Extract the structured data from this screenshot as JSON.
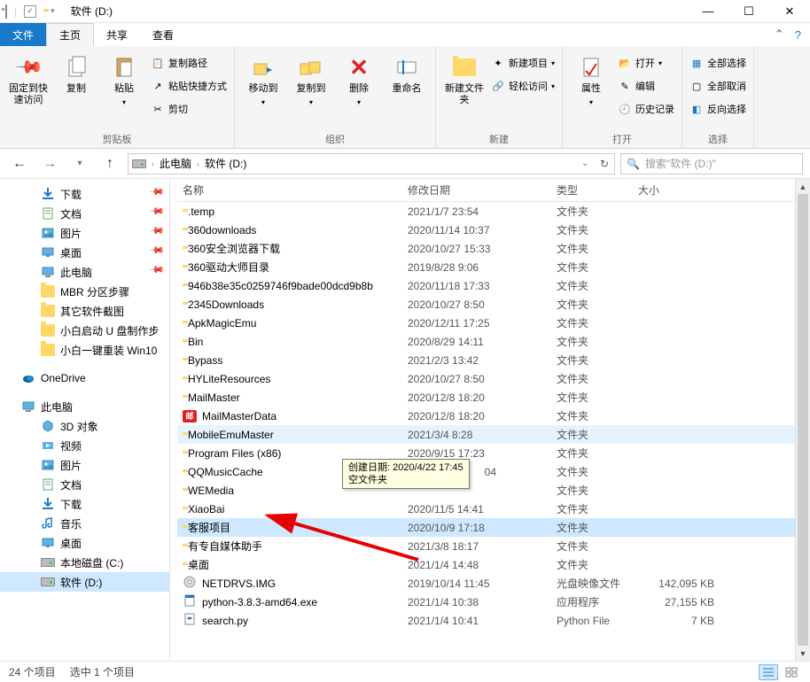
{
  "window": {
    "title": "软件 (D:)",
    "min": "—",
    "max": "☐",
    "close": "✕"
  },
  "tabs": {
    "file": "文件",
    "home": "主页",
    "share": "共享",
    "view": "查看"
  },
  "ribbon": {
    "group_clipboard": "剪贴板",
    "group_organize": "组织",
    "group_new": "新建",
    "group_open": "打开",
    "group_select": "选择",
    "pin_quick": "固定到快速访问",
    "copy": "复制",
    "paste": "粘贴",
    "copy_path": "复制路径",
    "paste_shortcut": "粘贴快捷方式",
    "cut": "剪切",
    "move_to": "移动到",
    "copy_to": "复制到",
    "delete": "删除",
    "rename": "重命名",
    "new_folder": "新建文件夹",
    "new_item": "新建项目",
    "easy_access": "轻松访问",
    "properties": "属性",
    "open": "打开",
    "edit": "编辑",
    "history": "历史记录",
    "select_all": "全部选择",
    "select_none": "全部取消",
    "invert_selection": "反向选择"
  },
  "address": {
    "this_pc": "此电脑",
    "current": "软件 (D:)"
  },
  "search": {
    "placeholder": "搜索\"软件 (D:)\""
  },
  "sidebar": {
    "items": [
      {
        "label": "下载",
        "icon": "download",
        "indent": 1,
        "pinned": true
      },
      {
        "label": "文档",
        "icon": "document",
        "indent": 1,
        "pinned": true
      },
      {
        "label": "图片",
        "icon": "pictures",
        "indent": 1,
        "pinned": true
      },
      {
        "label": "桌面",
        "icon": "desktop",
        "indent": 1,
        "pinned": true
      },
      {
        "label": "此电脑",
        "icon": "pc",
        "indent": 1,
        "pinned": true
      },
      {
        "label": "MBR 分区步骤",
        "icon": "folder",
        "indent": 1
      },
      {
        "label": "其它软件截图",
        "icon": "folder",
        "indent": 1
      },
      {
        "label": "小白启动 U 盘制作步",
        "icon": "folder",
        "indent": 1
      },
      {
        "label": "小白一键重装 Win10",
        "icon": "folder",
        "indent": 1
      },
      {
        "label": "",
        "icon": "spacer"
      },
      {
        "label": "OneDrive",
        "icon": "onedrive",
        "indent": 0
      },
      {
        "label": "",
        "icon": "spacer"
      },
      {
        "label": "此电脑",
        "icon": "pc",
        "indent": 0
      },
      {
        "label": "3D 对象",
        "icon": "3d",
        "indent": 1
      },
      {
        "label": "视频",
        "icon": "videos",
        "indent": 1
      },
      {
        "label": "图片",
        "icon": "pictures",
        "indent": 1
      },
      {
        "label": "文档",
        "icon": "document",
        "indent": 1
      },
      {
        "label": "下载",
        "icon": "download",
        "indent": 1
      },
      {
        "label": "音乐",
        "icon": "music",
        "indent": 1
      },
      {
        "label": "桌面",
        "icon": "desktop",
        "indent": 1
      },
      {
        "label": "本地磁盘 (C:)",
        "icon": "drive",
        "indent": 1
      },
      {
        "label": "软件 (D:)",
        "icon": "drive",
        "indent": 1,
        "selected": true
      }
    ]
  },
  "columns": {
    "name": "名称",
    "date": "修改日期",
    "type": "类型",
    "size": "大小"
  },
  "files": [
    {
      "name": ".temp",
      "date": "2021/1/7 23:54",
      "type": "文件夹",
      "size": "",
      "icon": "folder"
    },
    {
      "name": "360downloads",
      "date": "2020/11/14 10:37",
      "type": "文件夹",
      "size": "",
      "icon": "folder"
    },
    {
      "name": "360安全浏览器下载",
      "date": "2020/10/27 15:33",
      "type": "文件夹",
      "size": "",
      "icon": "folder"
    },
    {
      "name": "360驱动大师目录",
      "date": "2019/8/28 9:06",
      "type": "文件夹",
      "size": "",
      "icon": "folder"
    },
    {
      "name": "946b38e35c0259746f9bade00dcd9b8b",
      "date": "2020/11/18 17:33",
      "type": "文件夹",
      "size": "",
      "icon": "folder"
    },
    {
      "name": "2345Downloads",
      "date": "2020/10/27 8:50",
      "type": "文件夹",
      "size": "",
      "icon": "folder"
    },
    {
      "name": "ApkMagicEmu",
      "date": "2020/12/11 17:25",
      "type": "文件夹",
      "size": "",
      "icon": "folder"
    },
    {
      "name": "Bin",
      "date": "2020/8/29 14:11",
      "type": "文件夹",
      "size": "",
      "icon": "folder"
    },
    {
      "name": "Bypass",
      "date": "2021/2/3 13:42",
      "type": "文件夹",
      "size": "",
      "icon": "folder"
    },
    {
      "name": "HYLiteResources",
      "date": "2020/10/27 8:50",
      "type": "文件夹",
      "size": "",
      "icon": "folder"
    },
    {
      "name": "MailMaster",
      "date": "2020/12/8 18:20",
      "type": "文件夹",
      "size": "",
      "icon": "folder"
    },
    {
      "name": "MailMasterData",
      "date": "2020/12/8 18:20",
      "type": "文件夹",
      "size": "",
      "icon": "mailmaster"
    },
    {
      "name": "MobileEmuMaster",
      "date": "2021/3/4 8:28",
      "type": "文件夹",
      "size": "",
      "icon": "folder",
      "hover": true
    },
    {
      "name": "Program Files (x86)",
      "date": "2020/9/15 17:23",
      "type": "文件夹",
      "size": "",
      "icon": "folder"
    },
    {
      "name": "QQMusicCache",
      "date": "",
      "type": "文件夹",
      "size": "",
      "icon": "folder",
      "date_hidden": "04"
    },
    {
      "name": "WEMedia",
      "date": "",
      "type": "文件夹",
      "size": "",
      "icon": "folder"
    },
    {
      "name": "XiaoBai",
      "date": "2020/11/5 14:41",
      "type": "文件夹",
      "size": "",
      "icon": "folder"
    },
    {
      "name": "客服项目",
      "date": "2020/10/9 17:18",
      "type": "文件夹",
      "size": "",
      "icon": "folder",
      "selected": true
    },
    {
      "name": "有专自媒体助手",
      "date": "2021/3/8 18:17",
      "type": "文件夹",
      "size": "",
      "icon": "folder"
    },
    {
      "name": "桌面",
      "date": "2021/1/4 14:48",
      "type": "文件夹",
      "size": "",
      "icon": "folder"
    },
    {
      "name": "NETDRVS.IMG",
      "date": "2019/10/14 11:45",
      "type": "光盘映像文件",
      "size": "142,095 KB",
      "icon": "disc"
    },
    {
      "name": "python-3.8.3-amd64.exe",
      "date": "2021/1/4 10:38",
      "type": "应用程序",
      "size": "27,155 KB",
      "icon": "exe"
    },
    {
      "name": "search.py",
      "date": "2021/1/4 10:41",
      "type": "Python File",
      "size": "7 KB",
      "icon": "py"
    }
  ],
  "tooltip": {
    "line1": "创建日期: 2020/4/22 17:45",
    "line2": "空文件夹"
  },
  "status": {
    "total": "24 个项目",
    "selected": "选中 1 个项目"
  }
}
